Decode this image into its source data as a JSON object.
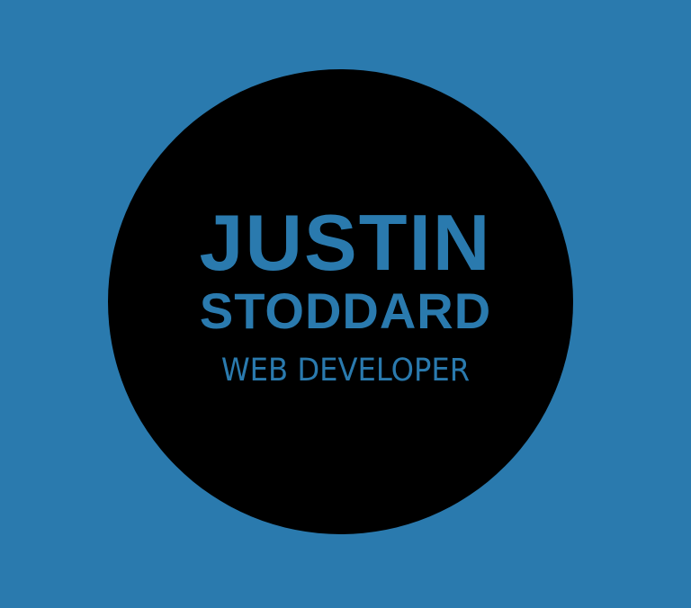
{
  "logo": {
    "first_name": "JUSTIN",
    "last_name": "STODDARD",
    "tagline": "WEB DEVELOPER"
  },
  "colors": {
    "background": "#2a7aae",
    "circle": "#000000",
    "text": "#2a7aae"
  }
}
